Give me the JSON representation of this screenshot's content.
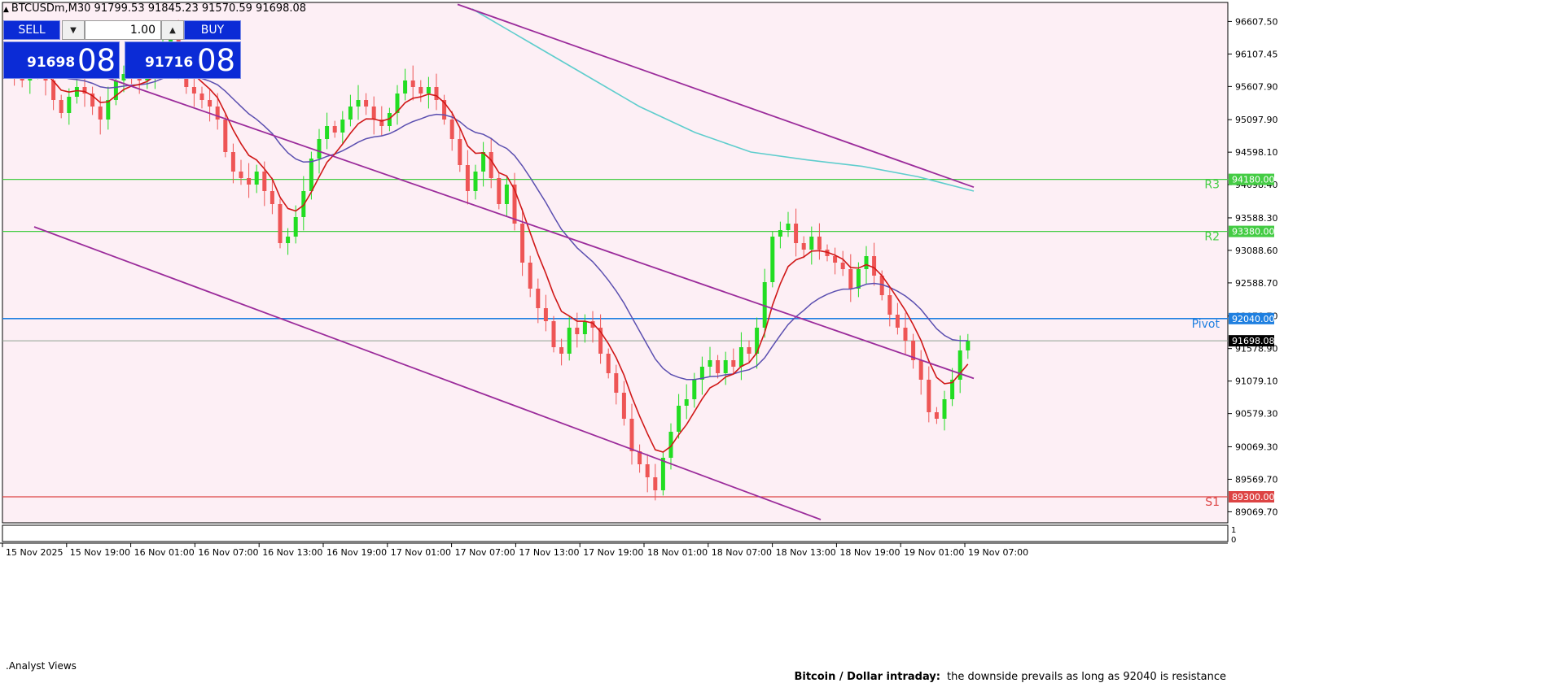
{
  "header": {
    "symbol_line": "BTCUSDm,M30  91799.53 91845.23 91570.59 91698.08"
  },
  "trade_panel": {
    "sell_label": "SELL",
    "buy_label": "BUY",
    "volume": "1.00",
    "volume_down_glyph": "▼",
    "volume_up_glyph": "▲",
    "sell_price_small": "91698",
    "sell_price_big": "08",
    "buy_price_small": "91716",
    "buy_price_big": "08"
  },
  "analyst": {
    "label": ".Analyst Views",
    "note_title": "Bitcoin / Dollar intraday:",
    "note_text": "the downside prevails as long as 92040 is resistance"
  },
  "colors": {
    "background": "#fdeff5",
    "bull": "#22dd22",
    "bear": "#ee5555",
    "ema_fast": "#d01818",
    "ema_mid": "#5b4fb0",
    "ema_slow": "#5fcdcd",
    "channel": "#9b2c9b",
    "resistance": "#44cc44",
    "pivot": "#1e7fe0",
    "support": "#dd4444",
    "panel_blue": "#0b2bd6"
  },
  "chart_data": {
    "type": "candlestick",
    "symbol": "BTCUSDm",
    "timeframe": "M30",
    "ylim": [
      88900,
      96900
    ],
    "y_ticks": [
      "96607.50",
      "96107.45",
      "95607.90",
      "95097.90",
      "94598.10",
      "94098.40",
      "93588.30",
      "93088.60",
      "92588.70",
      "92078.70",
      "91578.90",
      "91079.10",
      "90579.30",
      "90069.30",
      "89569.70",
      "89069.70"
    ],
    "x_ticks": [
      "15 Nov 2025",
      "15 Nov 19:00",
      "16 Nov 01:00",
      "16 Nov 07:00",
      "16 Nov 13:00",
      "16 Nov 19:00",
      "17 Nov 01:00",
      "17 Nov 07:00",
      "17 Nov 13:00",
      "17 Nov 19:00",
      "18 Nov 01:00",
      "18 Nov 07:00",
      "18 Nov 13:00",
      "18 Nov 19:00",
      "19 Nov 01:00",
      "19 Nov 07:00"
    ],
    "levels": [
      {
        "name": "R3",
        "value": 94180,
        "tag": "94180.00"
      },
      {
        "name": "R2",
        "value": 93380,
        "tag": "93380.00"
      },
      {
        "name": "Pivot",
        "value": 92040,
        "tag": "92040.00"
      },
      {
        "name": "S1",
        "value": 89300,
        "tag": "89300.00"
      }
    ],
    "last_price": 91698.08,
    "last_price_tag": "91698.08",
    "close_path": [
      95900,
      95800,
      95700,
      95850,
      95900,
      95700,
      95400,
      95200,
      95450,
      95600,
      95500,
      95300,
      95100,
      95400,
      95700,
      95800,
      95750,
      95700,
      95800,
      96000,
      96200,
      96500,
      95900,
      95600,
      95500,
      95400,
      95300,
      95100,
      94600,
      94300,
      94200,
      94100,
      94300,
      94000,
      93800,
      93200,
      93300,
      93600,
      94000,
      94500,
      94800,
      95000,
      94900,
      95100,
      95300,
      95400,
      95300,
      95100,
      95000,
      95200,
      95500,
      95700,
      95600,
      95500,
      95600,
      95400,
      95100,
      94800,
      94400,
      94000,
      94300,
      94600,
      94200,
      93800,
      94100,
      93500,
      92900,
      92500,
      92200,
      92000,
      91600,
      91500,
      91900,
      91800,
      92000,
      91900,
      91500,
      91200,
      90900,
      90500,
      90000,
      89800,
      89600,
      89400,
      89900,
      90300,
      90700,
      90800,
      91100,
      91300,
      91400,
      91200,
      91400,
      91300,
      91600,
      91500,
      91900,
      92600,
      93300,
      93400,
      93500,
      93200,
      93100,
      93300,
      93100,
      93000,
      92900,
      92800,
      92500,
      92800,
      93000,
      92700,
      92400,
      92100,
      91900,
      91700,
      91400,
      91100,
      90600,
      90500,
      90800,
      91100,
      91550,
      91698
    ]
  }
}
